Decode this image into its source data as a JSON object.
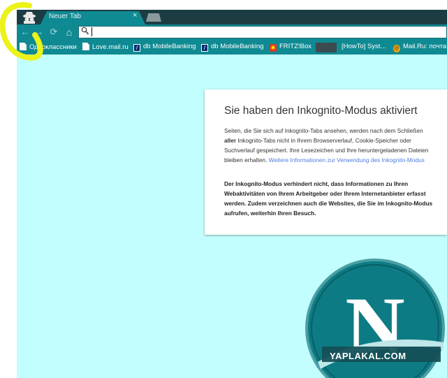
{
  "browser": {
    "tab": {
      "title": "Neuer Tab",
      "close_glyph": "×"
    },
    "nav": {
      "back_glyph": "←",
      "forward_glyph": "→",
      "reload_glyph": "⟳",
      "home_glyph": "⌂"
    },
    "omnibox": {
      "value": "",
      "icon": "search-icon"
    }
  },
  "bookmarks": [
    {
      "label": "Одноклассники",
      "icon": "page"
    },
    {
      "label": "Love.mail.ru",
      "icon": "page"
    },
    {
      "label": "db MobileBanking",
      "icon": "db"
    },
    {
      "label": "db MobileBanking",
      "icon": "db"
    },
    {
      "label": "FRITZ!Box",
      "icon": "fritz"
    },
    {
      "label": "[HowTo] Syst...",
      "icon": "page"
    },
    {
      "label": "Mail.Ru: почта,",
      "icon": "mailru"
    }
  ],
  "incognito": {
    "title": "Sie haben den Inkognito-Modus aktiviert",
    "p1_a": "Seiten, die Sie sich auf Inkognito-Tabs ansehen, werden nach dem Schließen ",
    "p1_bold": "aller",
    "p1_b": " Inkognito-Tabs nicht in Ihrem Browserverlauf, Cookie-Speicher oder Suchverlauf gespeichert. Ihre Lesezeichen und Ihre heruntergeladenen Dateien bleiben erhalten. ",
    "p1_link": "Weitere Informationen zur Verwendung des Inkognito-Modus",
    "p2": "Der Inkognito-Modus verhindert nicht, dass Informationen zu Ihren Webaktivitäten von Ihrem Arbeitgeber oder Ihrem Internetanbieter erfasst werden. Zudem verzeichnen auch die Websites, die Sie im Inkognito-Modus aufrufen, weiterhin Ihren Besuch."
  },
  "overlay": {
    "logo_letter": "N",
    "watermark": "YAPLAKAL.COM"
  },
  "colors": {
    "theme_teal": "#0f8a93",
    "titlebar_dark": "#1c3c43",
    "page_bg": "#c2fefd",
    "highlight_yellow": "#ecf21a"
  }
}
